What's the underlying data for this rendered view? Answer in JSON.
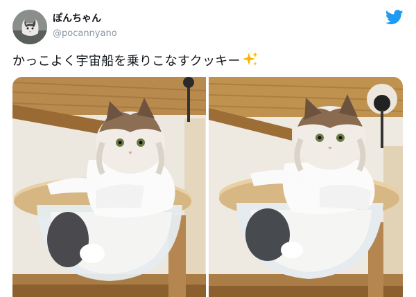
{
  "tweet": {
    "display_name": "ぽんちゃん",
    "handle": "@pocannyano",
    "text": "かっこよく宇宙船を乗りこなすクッキー",
    "sparkle_icon": "sparkles-emoji",
    "images": [
      {
        "description_name": "cat-in-bubble-bed-photo-1"
      },
      {
        "description_name": "cat-in-bubble-bed-photo-2"
      }
    ]
  },
  "colors": {
    "twitter_blue": "#1d9bf0",
    "handle_gray": "#8b949e",
    "text": "#0f1419",
    "sparkle": "#f5b800"
  }
}
